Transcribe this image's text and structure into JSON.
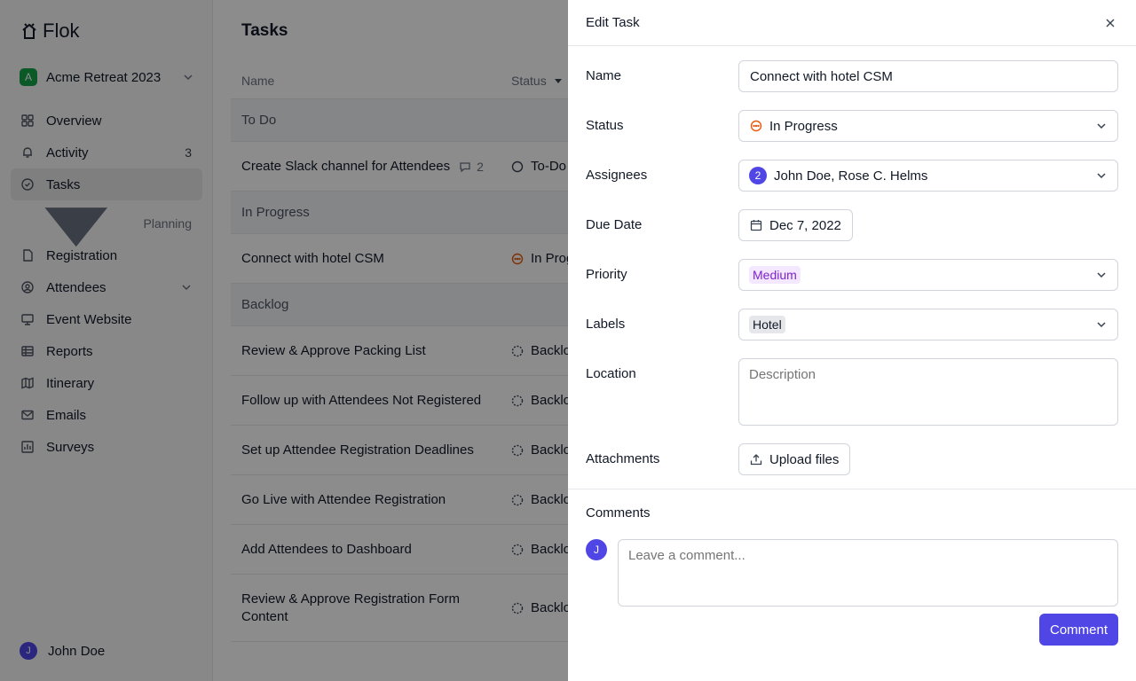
{
  "app": {
    "name": "Flok"
  },
  "retreat": {
    "initial": "A",
    "name": "Acme Retreat 2023",
    "badge_color": "#16a34a"
  },
  "nav": [
    {
      "label": "Overview",
      "icon": "grid-icon"
    },
    {
      "label": "Activity",
      "icon": "bell-icon",
      "count": "3"
    },
    {
      "label": "Tasks",
      "icon": "check-circle-icon",
      "active": true
    }
  ],
  "planning": {
    "label": "Planning",
    "items": [
      {
        "label": "Registration",
        "icon": "file-icon"
      },
      {
        "label": "Attendees",
        "icon": "user-circle-icon"
      },
      {
        "label": "Event Website",
        "icon": "monitor-icon"
      },
      {
        "label": "Reports",
        "icon": "table-icon"
      },
      {
        "label": "Itinerary",
        "icon": "map-icon"
      },
      {
        "label": "Emails",
        "icon": "mail-icon"
      },
      {
        "label": "Surveys",
        "icon": "chart-icon"
      }
    ]
  },
  "user": {
    "initial": "J",
    "name": "John Doe"
  },
  "page": {
    "title": "Tasks"
  },
  "table": {
    "columns": {
      "name": "Name",
      "status": "Status"
    },
    "groups": [
      {
        "label": "To Do",
        "rows": [
          {
            "name": "Create Slack channel for Attendees",
            "comments": "2",
            "status": "To-Do"
          }
        ]
      },
      {
        "label": "In Progress",
        "rows": [
          {
            "name": "Connect with hotel CSM",
            "status": "In Progress"
          }
        ]
      },
      {
        "label": "Backlog",
        "rows": [
          {
            "name": "Review & Approve Packing List",
            "status": "Backlog"
          },
          {
            "name": "Follow up with Attendees Not Registered",
            "status": "Backlog"
          },
          {
            "name": "Set up Attendee Registration Deadlines",
            "status": "Backlog"
          },
          {
            "name": "Go Live with Attendee Registration",
            "status": "Backlog"
          },
          {
            "name": "Add Attendees to Dashboard",
            "status": "Backlog"
          },
          {
            "name": "Review & Approve Registration Form Content",
            "status": "Backlog"
          }
        ]
      }
    ]
  },
  "panel": {
    "title": "Edit Task",
    "fields": {
      "name_label": "Name",
      "name_value": "Connect with hotel CSM",
      "status_label": "Status",
      "status_value": "In Progress",
      "assignees_label": "Assignees",
      "assignees_count": "2",
      "assignees_value": "John Doe, Rose C. Helms",
      "due_label": "Due Date",
      "due_value": "Dec 7, 2022",
      "priority_label": "Priority",
      "priority_value": "Medium",
      "labels_label": "Labels",
      "labels_value": "Hotel",
      "location_label": "Location",
      "location_placeholder": "Description",
      "attachments_label": "Attachments",
      "upload_label": "Upload files"
    },
    "comments": {
      "title": "Comments",
      "avatar_initial": "J",
      "placeholder": "Leave a comment...",
      "submit_label": "Comment"
    }
  },
  "colors": {
    "accent": "#4f46e5",
    "in_progress": "#ea580c",
    "priority_medium": "#7e22ce"
  }
}
